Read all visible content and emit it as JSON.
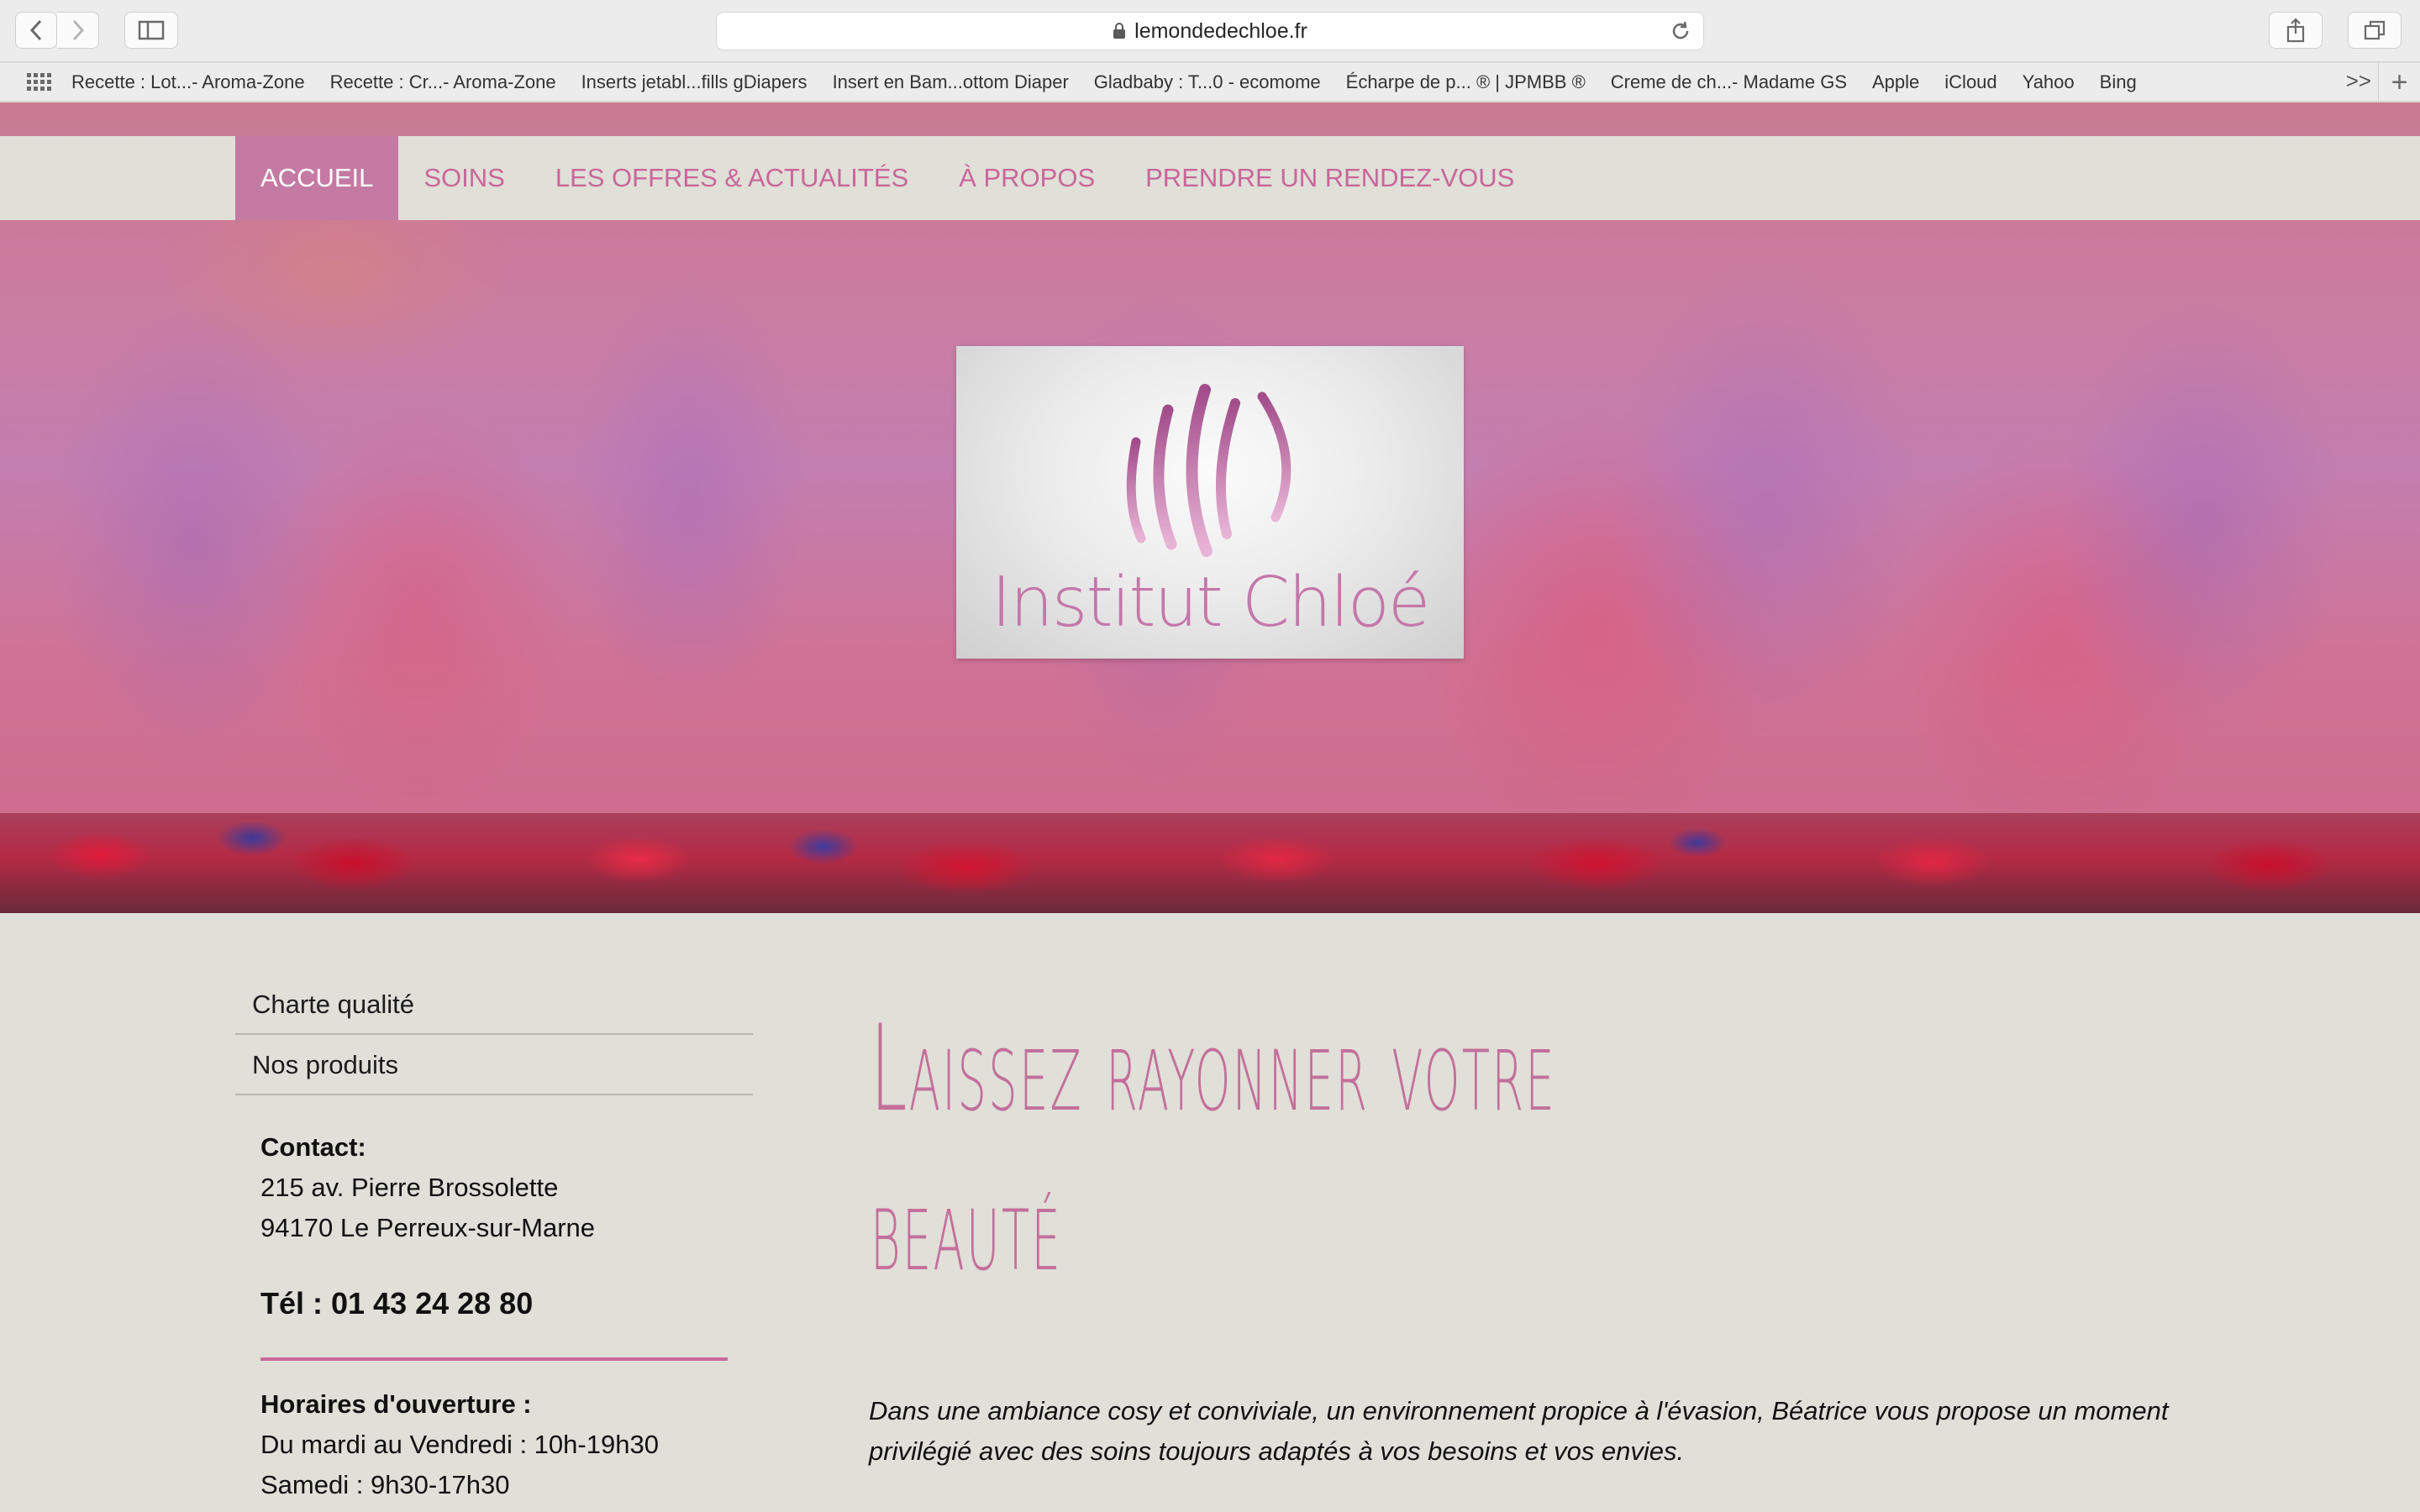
{
  "browser": {
    "url": "lemondedechloe.fr",
    "favorites": [
      "Recette : Lot...- Aroma-Zone",
      "Recette : Cr...- Aroma-Zone",
      "Inserts jetabl...fills gDiapers",
      "Insert en Bam...ottom Diaper",
      "Gladbaby : T...0 - ecomome",
      "Écharpe de p... ® | JPMBB ®",
      "Creme de ch...- Madame GS",
      "Apple",
      "iCloud",
      "Yahoo",
      "Bing"
    ],
    "more_label": ">>",
    "add_label": "+"
  },
  "nav": {
    "items": [
      "Accueil",
      "Soins",
      "Les offres & actualités",
      "À propos",
      "Prendre un rendez-vous"
    ],
    "active_index": 0
  },
  "logo": {
    "name": "Institut Chloé"
  },
  "sidebar": {
    "links": [
      "Charte qualité",
      "Nos produits"
    ],
    "contact_label": "Contact:",
    "address_line1": "215 av. Pierre Brossolette",
    "address_line2": "94170 Le Perreux-sur-Marne",
    "tel": "Tél : 01 43 24 28 80",
    "hours_label": "Horaires d'ouverture :",
    "hours_line1": "Du mardi au Vendredi : 10h-19h30",
    "hours_line2": "Samedi : 9h30-17h30"
  },
  "main": {
    "headline_line1": "Laissez rayonner votre",
    "headline_line2": "beauté",
    "intro": "Dans une ambiance cosy et conviviale, un environnement propice à l'évasion, Béatrice vous propose un moment privilégié avec des soins toujours adaptés à vos besoins et vos envies."
  },
  "colors": {
    "accent": "#c9669a",
    "nav_active_bg": "#c57aa3",
    "page_bg": "#e0dfd8"
  }
}
